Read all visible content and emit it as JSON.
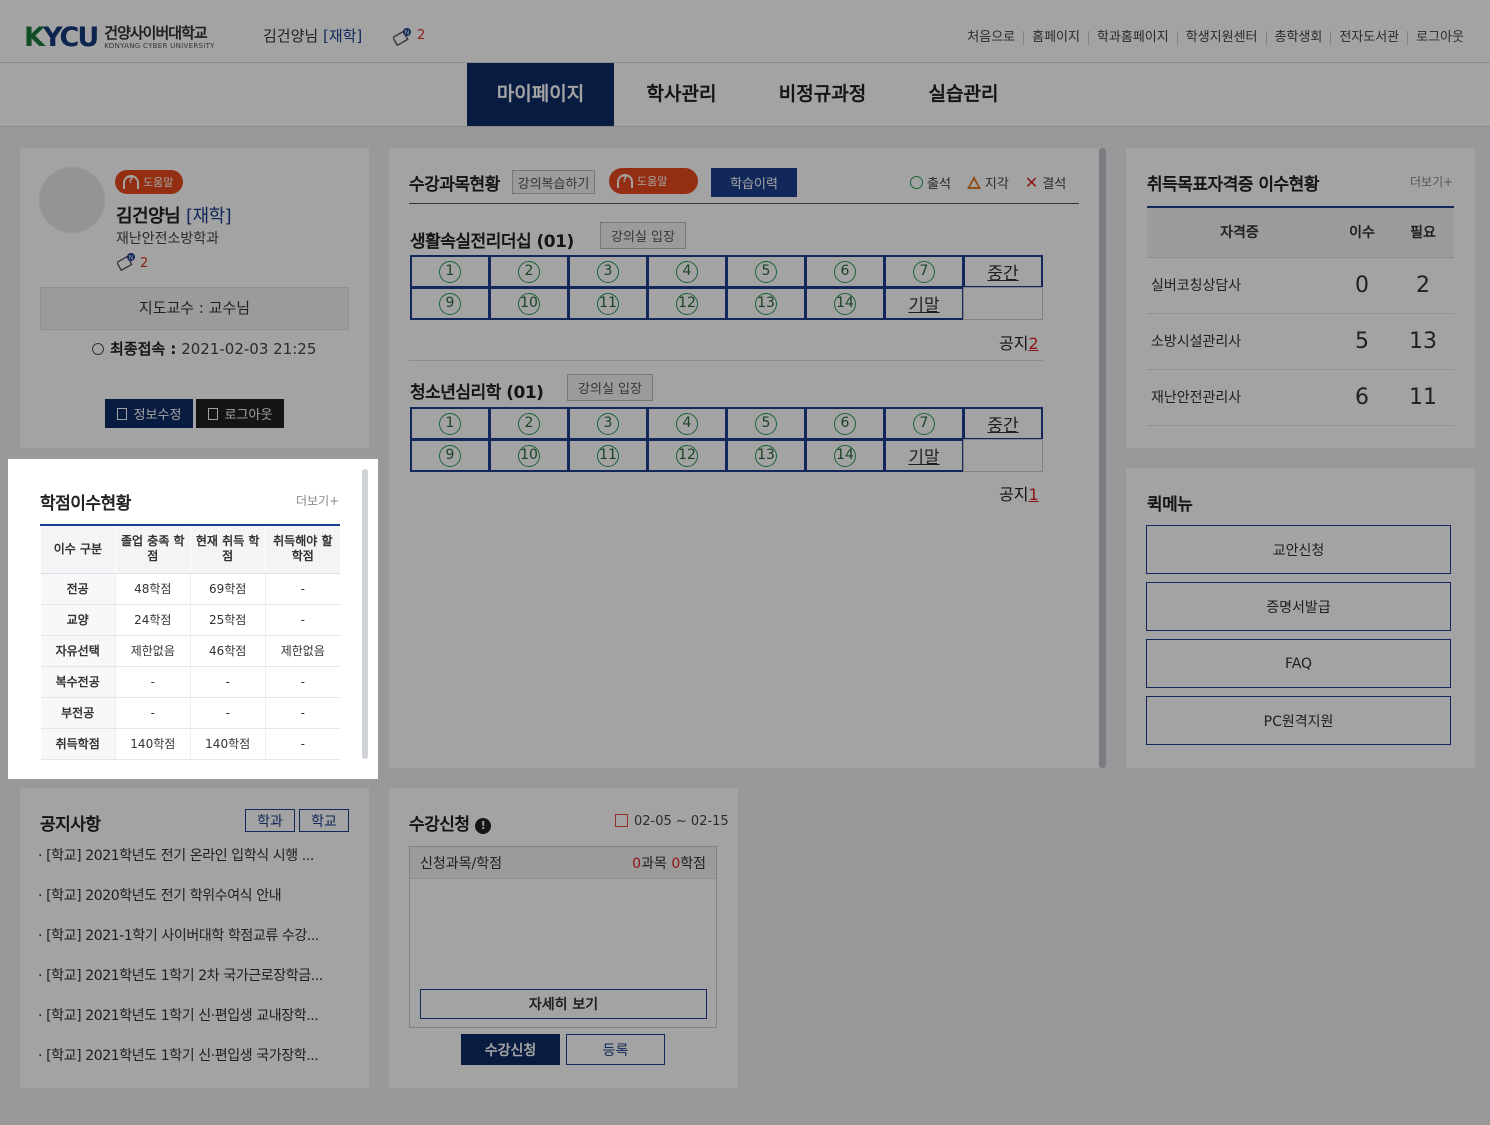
{
  "header": {
    "logo_mark_a": "K",
    "logo_mark_b": "YCU",
    "logo_kr": "건양사이버대학교",
    "logo_en": "KONYANG CYBER UNIVERSITY",
    "user_name": "김건양님",
    "user_status": "[재학]",
    "message_count": "2",
    "topnav": [
      "처음으로",
      "홈페이지",
      "학과홈페이지",
      "학생지원센터",
      "총학생회",
      "전자도서관",
      "로그아웃"
    ]
  },
  "gnb": {
    "items": [
      "마이페이지",
      "학사관리",
      "비정규과정",
      "실습관리"
    ],
    "active_index": 0
  },
  "profile": {
    "help_label": "도움말",
    "name": "김건양님",
    "status": "[재학]",
    "dept": "재난안전소방학과",
    "message_count": "2",
    "advisor": "지도교수 : 교수님",
    "last_login_label": "최종접속 :",
    "last_login_value": "2021-02-03 21:25",
    "edit_btn": "정보수정",
    "logout_btn": "로그아웃"
  },
  "credits": {
    "title": "학점이수현황",
    "more": "더보기+",
    "headers": [
      "이수 구분",
      "졸업 충족 학점",
      "현재 취득 학점",
      "취득해야 할 학점"
    ],
    "rows": [
      {
        "type": "전공",
        "required": "48학점",
        "earned": "69학점",
        "remaining": "-"
      },
      {
        "type": "교양",
        "required": "24학점",
        "earned": "25학점",
        "remaining": "-"
      },
      {
        "type": "자유선택",
        "required": "제한없음",
        "earned": "46학점",
        "remaining": "제한없음"
      },
      {
        "type": "복수전공",
        "required": "-",
        "earned": "-",
        "remaining": "-"
      },
      {
        "type": "부전공",
        "required": "-",
        "earned": "-",
        "remaining": "-"
      },
      {
        "type": "취득학점",
        "required": "140학점",
        "earned": "140학점",
        "remaining": "-"
      }
    ]
  },
  "courses": {
    "title": "수강과목현황",
    "review_btn": "강의복습하기",
    "help_label": "도움말",
    "history_btn": "학습이력",
    "legend": {
      "present": "출석",
      "late": "지각",
      "absent": "결석"
    },
    "enter_btn": "강의실 입장",
    "midterm": "중간",
    "final": "기말",
    "notice_label": "공지",
    "weeks_row1": [
      "1",
      "2",
      "3",
      "4",
      "5",
      "6",
      "7"
    ],
    "weeks_row2": [
      "9",
      "10",
      "11",
      "12",
      "13",
      "14"
    ],
    "list": [
      {
        "name": "생활속실전리더십 (01)",
        "notice_count": "2"
      },
      {
        "name": "청소년심리학 (01)",
        "notice_count": "1"
      }
    ]
  },
  "certs": {
    "title": "취득목표자격증 이수현황",
    "more": "더보기+",
    "headers": [
      "자격증",
      "이수",
      "필요"
    ],
    "rows": [
      {
        "name": "실버코칭상담사",
        "done": "0",
        "need": "2"
      },
      {
        "name": "소방시설관리사",
        "done": "5",
        "need": "13"
      },
      {
        "name": "재난안전관리사",
        "done": "6",
        "need": "11"
      }
    ]
  },
  "quick": {
    "title": "퀵메뉴",
    "items": [
      "교안신청",
      "증명서발급",
      "FAQ",
      "PC원격지원"
    ]
  },
  "notices": {
    "title": "공지사항",
    "tab_dept": "학과",
    "tab_school": "학교",
    "items": [
      "· [학교] 2021학년도 전기 온라인 입학식 시행 ...",
      "· [학교] 2020학년도 전기 학위수여식 안내",
      "· [학교] 2021-1학기 사이버대학 학점교류 수강...",
      "· [학교] 2021학년도 1학기 2차 국가근로장학금...",
      "· [학교] 2021학년도 1학기 신·편입생 교내장학...",
      "· [학교] 2021학년도 1학기 신·편입생 국가장학..."
    ]
  },
  "registration": {
    "title": "수강신청",
    "period": "02-05 ~ 02-15",
    "summary_label": "신청과목/학점",
    "course_count": "0",
    "course_unit": "과목",
    "credit_count": "0",
    "credit_unit": "학점",
    "detail_btn": "자세히 보기",
    "apply_btn": "수강신청",
    "register_btn": "등록"
  },
  "colors": {
    "navy": "#0d2b66",
    "accent_blue": "#1d3f8f",
    "red": "#e02020",
    "green": "#2a9a55",
    "orange": "#e8491d"
  }
}
